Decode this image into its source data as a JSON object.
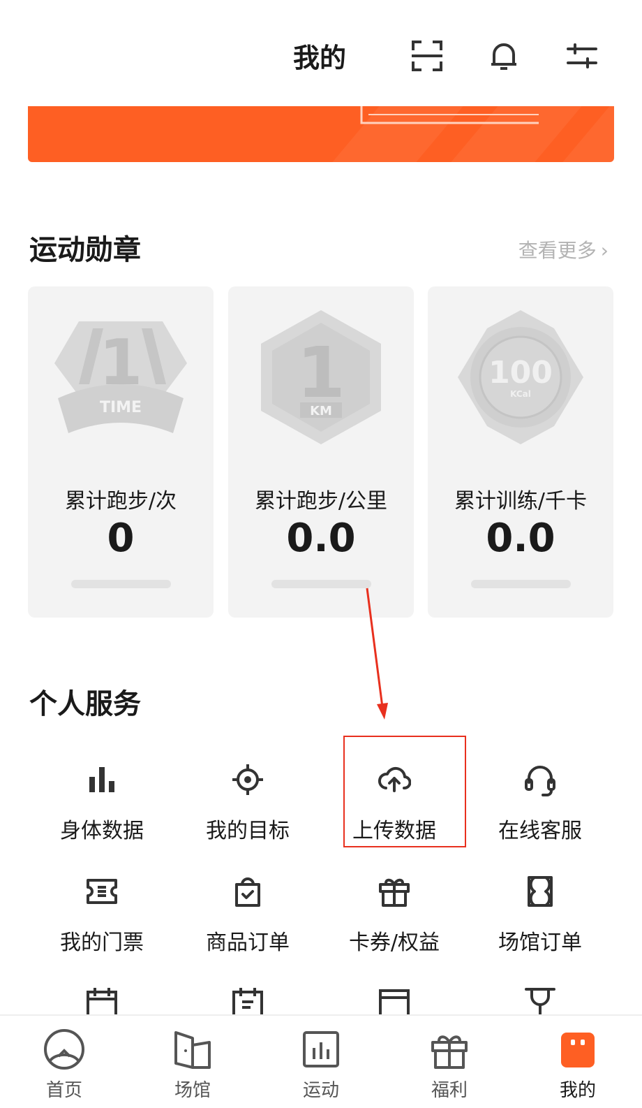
{
  "header": {
    "title": "我的"
  },
  "medals": {
    "title": "运动勋章",
    "more": "查看更多",
    "cards": [
      {
        "badge_text": "TIME",
        "badge_number": "1",
        "label": "累计跑步/次",
        "value": "0"
      },
      {
        "badge_text": "KM",
        "badge_number": "1",
        "label": "累计跑步/公里",
        "value": "0.0"
      },
      {
        "badge_text": "KCal",
        "badge_number": "100",
        "label": "累计训练/千卡",
        "value": "0.0"
      }
    ]
  },
  "services": {
    "title": "个人服务",
    "items": [
      {
        "label": "身体数据",
        "icon": "bar-chart-icon"
      },
      {
        "label": "我的目标",
        "icon": "target-icon"
      },
      {
        "label": "上传数据",
        "icon": "cloud-upload-icon"
      },
      {
        "label": "在线客服",
        "icon": "headset-icon"
      },
      {
        "label": "我的门票",
        "icon": "ticket-icon"
      },
      {
        "label": "商品订单",
        "icon": "shopping-bag-icon"
      },
      {
        "label": "卡券/权益",
        "icon": "gift-icon"
      },
      {
        "label": "场馆订单",
        "icon": "venue-order-icon"
      }
    ]
  },
  "nav": {
    "items": [
      {
        "label": "首页",
        "icon": "home-icon"
      },
      {
        "label": "场馆",
        "icon": "venue-icon"
      },
      {
        "label": "运动",
        "icon": "sport-icon"
      },
      {
        "label": "福利",
        "icon": "gift-icon"
      },
      {
        "label": "我的",
        "icon": "profile-icon",
        "active": true
      }
    ],
    "active_color": "#fe5f23"
  },
  "colors": {
    "accent": "#fe5f23",
    "annotation": "#e8301e"
  }
}
